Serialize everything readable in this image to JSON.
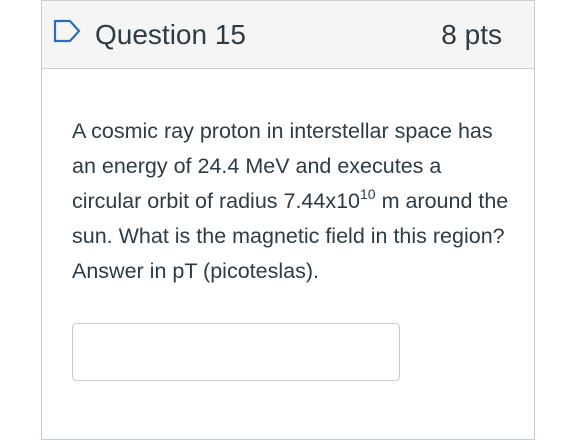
{
  "question": {
    "title": "Question 15",
    "points": "8 pts",
    "flag_icon": "flag-outline-icon",
    "accent_color": "#2d6fb7",
    "text_parts": {
      "before_exponent": "A cosmic ray proton in interstellar space has an energy of 24.4 MeV and executes a circular orbit of radius 7.44x10",
      "exponent": "10",
      "after_exponent": " m around the sun. What is the magnetic field in this region? Answer in pT (picoteslas)."
    },
    "answer_value": ""
  }
}
